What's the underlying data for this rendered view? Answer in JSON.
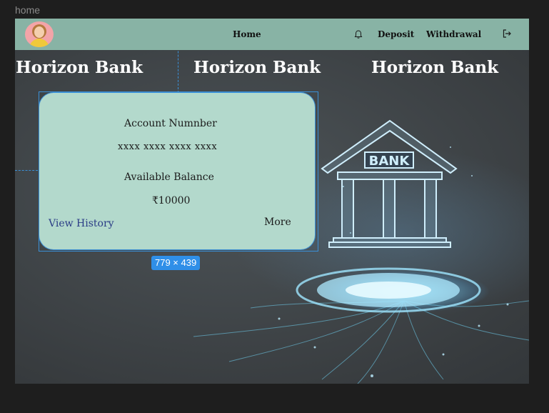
{
  "frame": {
    "label": "home"
  },
  "navbar": {
    "avatar_alt": "User profile",
    "home_label": "Home",
    "deposit_label": "Deposit",
    "withdrawal_label": "Withdrawal",
    "bell_icon": "bell-icon",
    "logout_icon": "logout-icon",
    "background": "#88b3a5"
  },
  "headings": [
    "Horizon Bank",
    "Horizon Bank",
    "Horizon Bank"
  ],
  "card": {
    "account_label": "Account Numnber",
    "account_number": "xxxx xxxx xxxx xxxx",
    "balance_label": "Available Balance",
    "balance_value": "₹10000",
    "view_history_label": "View History",
    "more_label": "More",
    "background": "#b3d9cc"
  },
  "illustration": {
    "sign_text": "BANK"
  },
  "selection": {
    "size_label": "779 × 439"
  }
}
